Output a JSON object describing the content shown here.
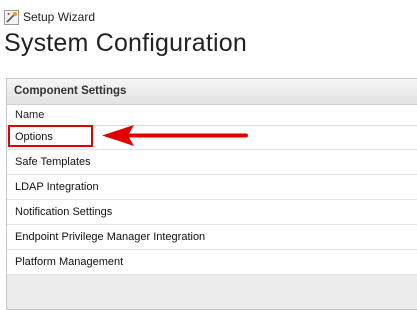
{
  "wizard": {
    "icon": "wizard-wand-icon",
    "label": "Setup Wizard"
  },
  "page": {
    "title": "System Configuration"
  },
  "panel": {
    "header": "Component Settings",
    "column_header": "Name",
    "items": [
      {
        "label": "Options"
      },
      {
        "label": "Safe Templates"
      },
      {
        "label": "LDAP Integration"
      },
      {
        "label": "Notification Settings"
      },
      {
        "label": "Endpoint Privilege Manager Integration"
      },
      {
        "label": "Platform Management"
      }
    ]
  },
  "annotation": {
    "color": "#e00000",
    "target": "Options"
  }
}
